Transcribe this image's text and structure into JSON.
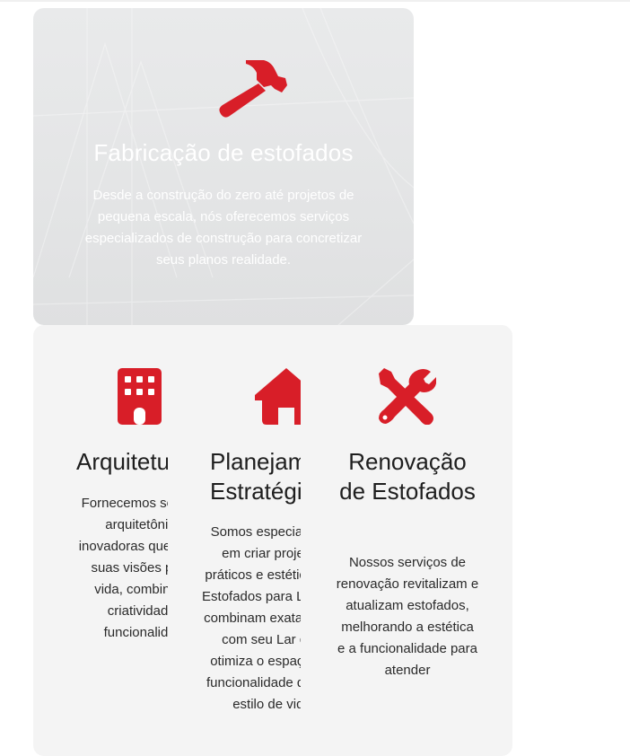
{
  "hero": {
    "title": "Fabricação de estofados",
    "description": "Desde a construção do zero até projetos de pequena escala, nós oferecemos serviços especializados de construção para concretizar seus planos realidade.",
    "icon": "hammer-icon",
    "accent_color": "#d81e28"
  },
  "services": [
    {
      "title": "Arquitetura",
      "description": "Fornecemos soluções arquitetônicas inovadoras que trazem suas visões para a vida, combinando criatividade e funcionalidade",
      "icon": "building-icon"
    },
    {
      "title": "Planejamento Estratégico",
      "description": "Somos especialistas em criar projetos práticos e estéticos de Estofados para Lar que combinam exatamente com seu Lar que otimiza o espaço e a funcionalidade de seu estilo de vida",
      "icon": "house-icon"
    },
    {
      "title": "Renovação de Estofados",
      "description": "Nossos serviços de renovação revitalizam e atualizam estofados, melhorando a estética e a funcionalidade para atender",
      "icon": "tools-icon"
    }
  ]
}
